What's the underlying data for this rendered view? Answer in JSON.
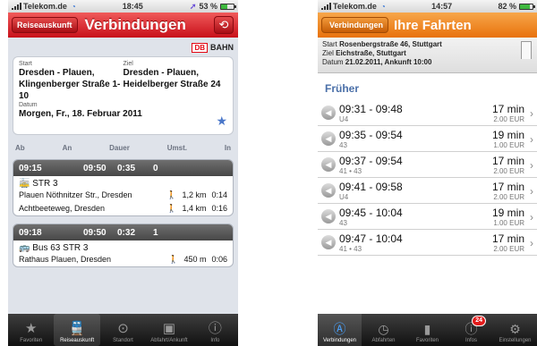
{
  "left": {
    "status": {
      "carrier": "Telekom.de",
      "time": "18:45",
      "battery": "53 %",
      "battery_level": 0.53
    },
    "nav": {
      "back": "Reiseauskunft",
      "title": "Verbindungen"
    },
    "brand": {
      "logo": "DB",
      "name": "BAHN"
    },
    "search": {
      "start_label": "Start",
      "start": "Dresden - Plauen, Klingenberger Straße 1-10",
      "ziel_label": "Ziel",
      "ziel": "Dresden - Plauen, Heidelberger Straße 24",
      "datum_label": "Datum",
      "datum": "Morgen, Fr., 18. Februar 2011"
    },
    "columns": {
      "ab": "Ab",
      "an": "An",
      "dauer": "Dauer",
      "umst": "Umst.",
      "in": "In"
    },
    "connections": [
      {
        "ab": "09:15",
        "an": "09:50",
        "dauer": "0:35",
        "umst": "0",
        "line": "STR 3",
        "legs": [
          {
            "stop": "Plauen Nöthnitzer Str., Dresden",
            "dist": "1,2 km",
            "time": "0:14"
          },
          {
            "stop": "Achtbeeteweg, Dresden",
            "dist": "1,4 km",
            "time": "0:16"
          }
        ]
      },
      {
        "ab": "09:18",
        "an": "09:50",
        "dauer": "0:32",
        "umst": "1",
        "line": "Bus 63   STR 3",
        "legs": [
          {
            "stop": "Rathaus Plauen, Dresden",
            "dist": "450 m",
            "time": "0:06"
          }
        ]
      }
    ],
    "tabs": [
      "Favoriten",
      "Reiseauskunft",
      "Standort",
      "Abfahrt/Ankunft",
      "Info"
    ]
  },
  "right": {
    "status": {
      "carrier": "Telekom.de",
      "time": "14:57",
      "battery": "82 %",
      "battery_level": 0.82
    },
    "nav": {
      "back": "Verbindungen",
      "title": "Ihre Fahrten"
    },
    "info": {
      "start_label": "Start",
      "start": "Rosenbergstraße 46, Stuttgart",
      "ziel_label": "Ziel",
      "ziel": "Eichstraße, Stuttgart",
      "datum_label": "Datum",
      "datum": "21.02.2011, Ankunft 10:00"
    },
    "section": "Früher",
    "trips": [
      {
        "time": "09:31 - 09:48",
        "line": "U4",
        "dur": "17 min",
        "price": "2.00 EUR"
      },
      {
        "time": "09:35 - 09:54",
        "line": "43",
        "dur": "19 min",
        "price": "1.00 EUR"
      },
      {
        "time": "09:37 - 09:54",
        "line": "41 • 43",
        "dur": "17 min",
        "price": "2.00 EUR"
      },
      {
        "time": "09:41 - 09:58",
        "line": "U4",
        "dur": "17 min",
        "price": "2.00 EUR"
      },
      {
        "time": "09:45 - 10:04",
        "line": "43",
        "dur": "19 min",
        "price": "1.00 EUR"
      },
      {
        "time": "09:47 - 10:04",
        "line": "41 • 43",
        "dur": "17 min",
        "price": "2.00 EUR"
      }
    ],
    "tabs": [
      "Verbindungen",
      "Abfahrten",
      "Favoriten",
      "Infos",
      "Einstellungen"
    ],
    "badge": "24"
  }
}
